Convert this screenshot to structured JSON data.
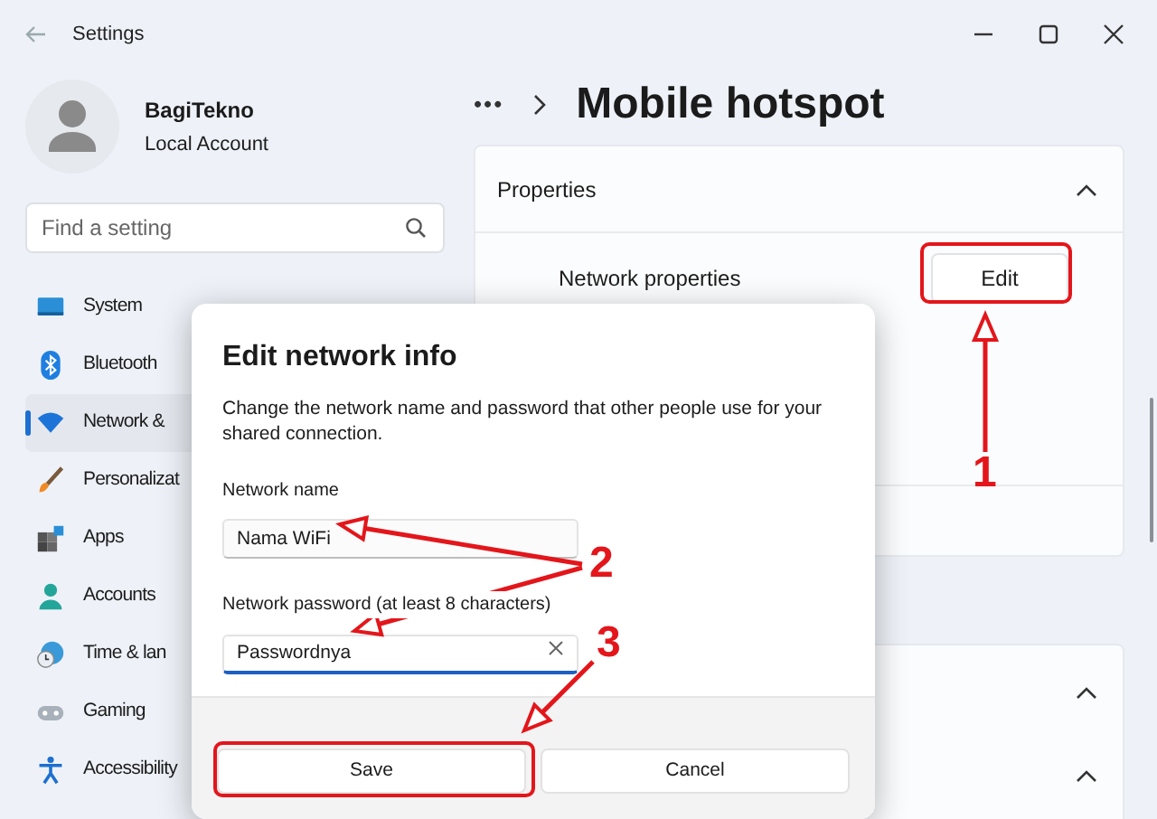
{
  "window": {
    "title": "Settings"
  },
  "account": {
    "name": "BagiTekno",
    "type": "Local Account"
  },
  "search": {
    "placeholder": "Find a setting"
  },
  "nav": [
    {
      "label": "System",
      "kind": "system",
      "selected": false
    },
    {
      "label": "Bluetooth",
      "kind": "bluetooth",
      "selected": false
    },
    {
      "label": "Network &",
      "kind": "network",
      "selected": true
    },
    {
      "label": "Personalizat",
      "kind": "brush",
      "selected": false
    },
    {
      "label": "Apps",
      "kind": "apps",
      "selected": false
    },
    {
      "label": "Accounts",
      "kind": "person",
      "selected": false
    },
    {
      "label": "Time & lan",
      "kind": "clock",
      "selected": false
    },
    {
      "label": "Gaming",
      "kind": "gamepad",
      "selected": false
    },
    {
      "label": "Accessibility",
      "kind": "accessibility",
      "selected": false
    }
  ],
  "breadcrumb": {
    "overflow": "•••",
    "page": "Mobile hotspot"
  },
  "properties_card": {
    "title": "Properties",
    "expanded": true,
    "rows": [
      {
        "label": "Network properties",
        "button": "Edit",
        "highlighted": true
      }
    ]
  },
  "lower_sections": [
    {
      "expanded": true
    },
    {
      "expanded": true
    }
  ],
  "dialog": {
    "title": "Edit network info",
    "description": "Change the network name and password that other people use for your shared connection.",
    "fields": [
      {
        "label": "Network name",
        "value": "Nama WiFi",
        "focused": false
      },
      {
        "label": "Network password (at least 8 characters)",
        "value": "Passwordnya",
        "focused": true
      }
    ],
    "buttons": [
      {
        "label": "Save",
        "highlighted": true
      },
      {
        "label": "Cancel",
        "highlighted": false
      }
    ]
  },
  "step_labels": [
    "1",
    "2",
    "3"
  ]
}
